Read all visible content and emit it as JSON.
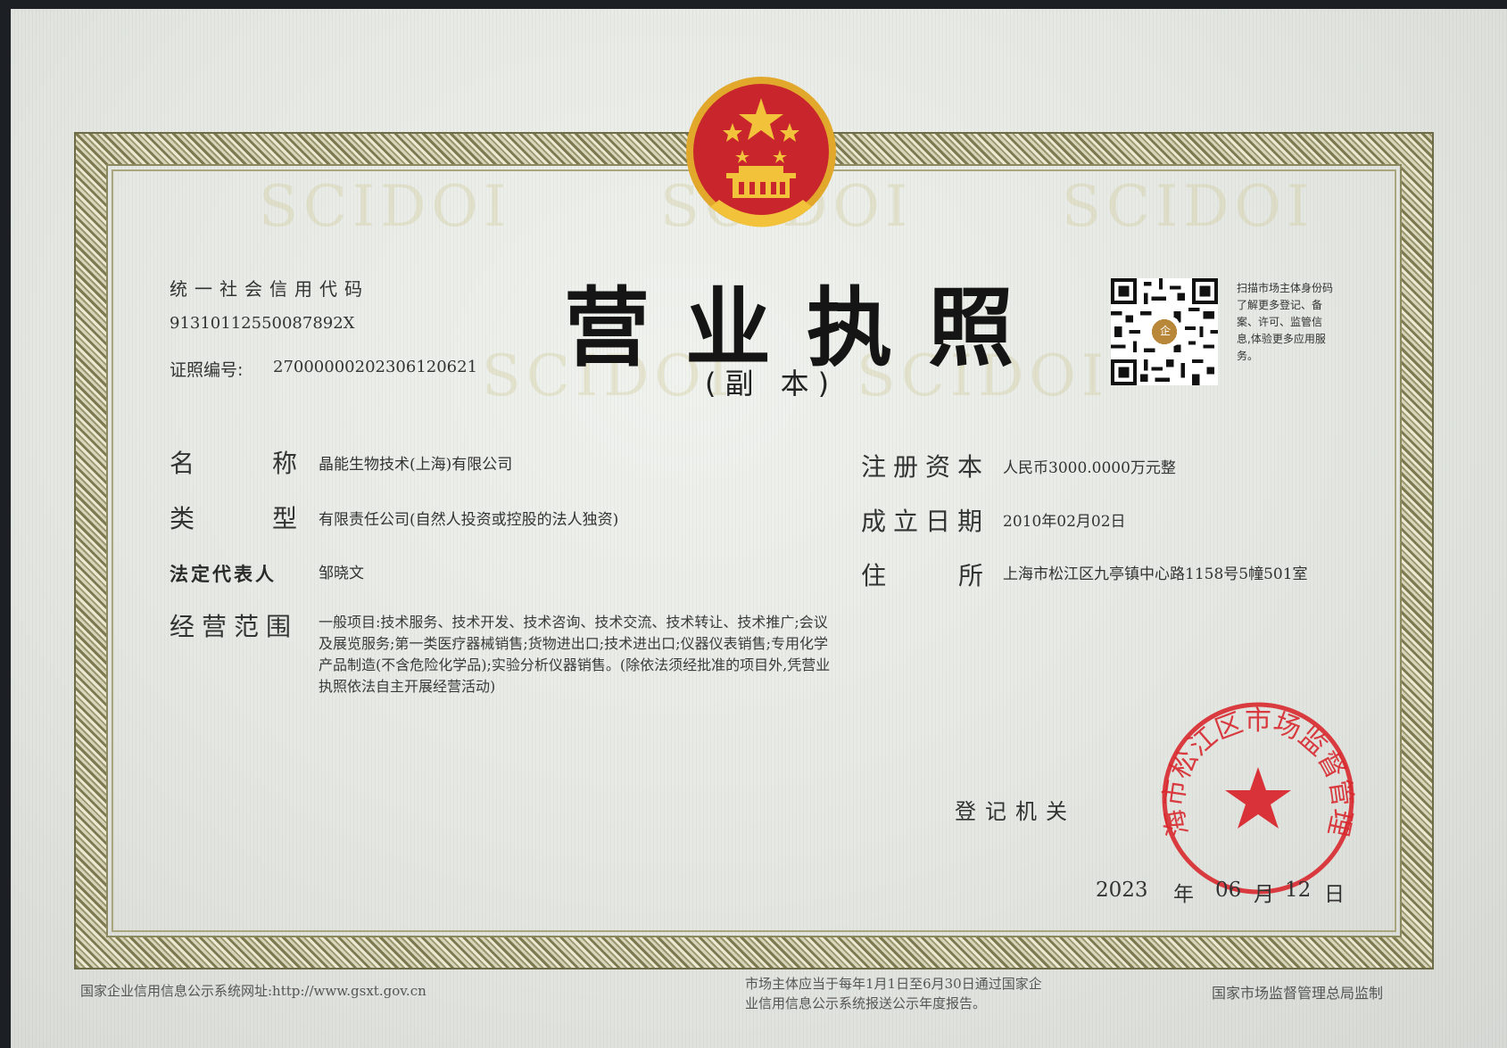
{
  "header": {
    "credit_code_label": "统一社会信用代码",
    "credit_code_value": "91310112550087892X",
    "license_no_label": "证照编号:",
    "license_no_value": "27000000202306120621",
    "title": "营业执照",
    "subtitle": "(副  本)"
  },
  "watermark_text": "SCIDOI",
  "qr": {
    "caption": "扫描市场主体身份码了解更多登记、备案、许可、监管信息,体验更多应用服务。",
    "center_glyph": "企"
  },
  "fields": {
    "name_label_1": "名",
    "name_label_2": "称",
    "name_value": "晶能生物技术(上海)有限公司",
    "type_label_1": "类",
    "type_label_2": "型",
    "type_value": "有限责任公司(自然人投资或控股的法人独资)",
    "legal_rep_label": "法定代表人",
    "legal_rep_value": "邹晓文",
    "scope_label": "经营范围",
    "scope_value": "一般项目:技术服务、技术开发、技术咨询、技术交流、技术转让、技术推广;会议及展览服务;第一类医疗器械销售;货物进出口;技术进出口;仪器仪表销售;专用化学产品制造(不含危险化学品);实验分析仪器销售。(除依法须经批准的项目外,凭营业执照依法自主开展经营活动)",
    "capital_label": "注册资本",
    "capital_value": "人民币3000.0000万元整",
    "established_label": "成立日期",
    "established_value": "2010年02月02日",
    "address_label_1": "住",
    "address_label_2": "所",
    "address_value": "上海市松江区九亭镇中心路1158号5幢501室"
  },
  "registration": {
    "authority_label": "登记机关",
    "year": "2023",
    "year_char": "年",
    "month": "06",
    "month_char": "月",
    "day": "12",
    "day_char": "日",
    "seal_text": "上海市松江区市场监督管理局"
  },
  "footer": {
    "left": "国家企业信用信息公示系统网址:http://www.gsxt.gov.cn",
    "middle": "市场主体应当于每年1月1日至6月30日通过国家企业信用信息公示系统报送公示年度报告。",
    "right": "国家市场监督管理总局监制"
  },
  "colors": {
    "emblem_red": "#c8262c",
    "emblem_gold": "#f2c23a",
    "seal_red": "#d8282e",
    "border_olive": "#7d7a52"
  }
}
